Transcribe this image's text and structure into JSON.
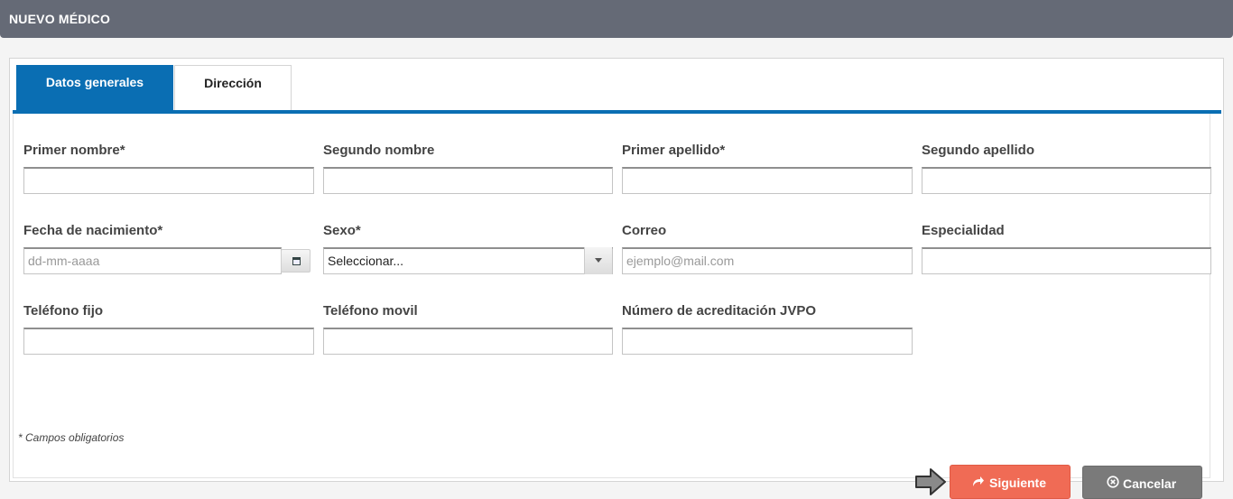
{
  "header": {
    "title": "NUEVO MÉDICO"
  },
  "tabs": [
    {
      "label": "Datos generales",
      "active": true
    },
    {
      "label": "Dirección",
      "active": false
    }
  ],
  "fields": {
    "primer_nombre": {
      "label": "Primer nombre*",
      "value": ""
    },
    "segundo_nombre": {
      "label": "Segundo nombre",
      "value": ""
    },
    "primer_apellido": {
      "label": "Primer apellido*",
      "value": ""
    },
    "segundo_apellido": {
      "label": "Segundo apellido",
      "value": ""
    },
    "fecha_nacimiento": {
      "label": "Fecha de nacimiento*",
      "placeholder": "dd-mm-aaaa",
      "value": ""
    },
    "sexo": {
      "label": "Sexo*",
      "selected": "Seleccionar..."
    },
    "correo": {
      "label": "Correo",
      "placeholder": "ejemplo@mail.com",
      "value": ""
    },
    "especialidad": {
      "label": "Especialidad",
      "value": ""
    },
    "telefono_fijo": {
      "label": "Teléfono fijo",
      "value": ""
    },
    "telefono_movil": {
      "label": "Teléfono movil",
      "value": ""
    },
    "acreditacion": {
      "label": "Número de acreditación JVPO",
      "value": ""
    }
  },
  "note": "* Campos obligatorios",
  "actions": {
    "next_label": "Siguiente",
    "cancel_label": "Cancelar"
  },
  "icons": {
    "next": "share-arrow-icon",
    "cancel": "circle-x-icon",
    "calendar": "calendar-icon",
    "pointer": "right-arrow-pointer-icon"
  },
  "colors": {
    "header_bg": "#656a76",
    "tab_active": "#0a6eb3",
    "next_button": "#f06b55",
    "cancel_button": "#7a7a7a"
  }
}
